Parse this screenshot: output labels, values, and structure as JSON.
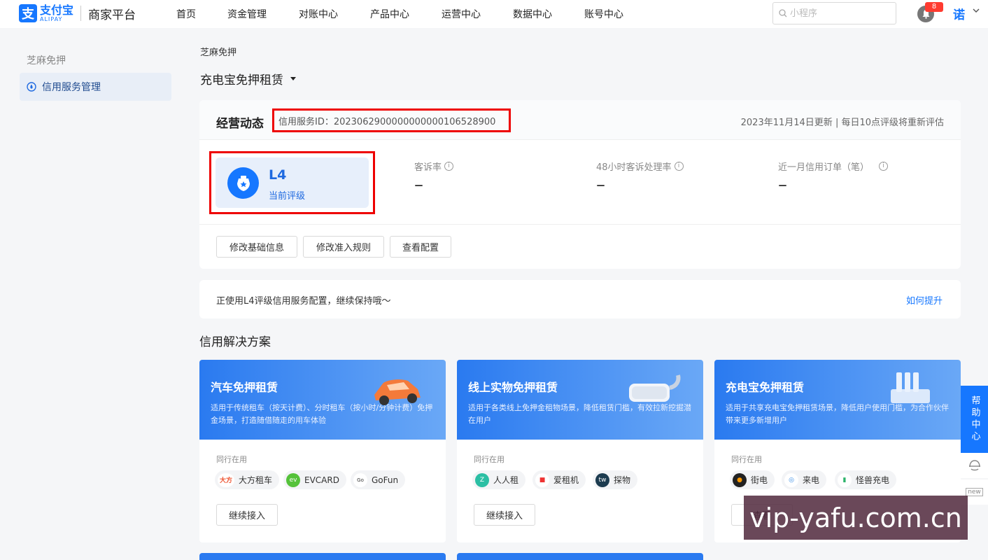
{
  "brand": {
    "mark": "支",
    "name_cn": "支付宝",
    "name_en": "ALIPAY",
    "platform": "商家平台",
    "color": "#1677ff"
  },
  "nav": {
    "items": [
      "首页",
      "资金管理",
      "对账中心",
      "产品中心",
      "运营中心",
      "数据中心",
      "账号中心"
    ]
  },
  "search": {
    "placeholder": "小程序"
  },
  "notifications": {
    "count": "8"
  },
  "user": {
    "avatar_glyph": "诺"
  },
  "sidebar": {
    "group_title": "芝麻免押",
    "items": [
      {
        "label": "信用服务管理",
        "icon": "credit-icon"
      }
    ]
  },
  "page": {
    "breadcrumb": "芝麻免押",
    "selector_label": "充电宝免押租赁"
  },
  "dashboard": {
    "title": "经营动态",
    "service_id": "信用服务ID：2023062900000000000106528900",
    "update_note": "2023年11月14日更新 | 每日10点评级将重新评估",
    "rating": {
      "level": "L4",
      "label": "当前评级"
    },
    "metrics": [
      {
        "label": "客诉率",
        "value": "–"
      },
      {
        "label": "48小时客诉处理率",
        "value": "–"
      },
      {
        "label": "近一月信用订单（笔）",
        "value": "–"
      }
    ],
    "buttons": [
      "修改基础信息",
      "修改准入规则",
      "查看配置"
    ]
  },
  "tip": {
    "text": "正使用L4评级信用服务配置，继续保持哦～",
    "link": "如何提升"
  },
  "solutions": {
    "title": "信用解决方案",
    "peer_label": "同行在用",
    "cards": [
      {
        "title": "汽车免押租赁",
        "desc": "适用于传统租车（按天计费）、分时租车（按小时/分钟计费）免押金场景，打造随借随走的用车体验",
        "peers": [
          "大方租车",
          "EVCARD",
          "GoFun"
        ],
        "button": "继续接入"
      },
      {
        "title": "线上实物免押租赁",
        "desc": "适用于各类线上免押金租物场景，降低租赁门槛，有效拉新挖掘潜在用户",
        "peers": [
          "人人租",
          "爱租机",
          "探物"
        ],
        "button": "继续接入"
      },
      {
        "title": "充电宝免押租赁",
        "desc": "适用于共享充电宝免押租赁场景，降低用户使用门槛，为合作伙伴带来更多新增用户",
        "peers": [
          "街电",
          "来电",
          "怪兽充电"
        ],
        "button": "查看"
      }
    ]
  },
  "help": {
    "label": "帮助中心",
    "new_label": "new"
  },
  "watermark": "vip-yafu.com.cn"
}
